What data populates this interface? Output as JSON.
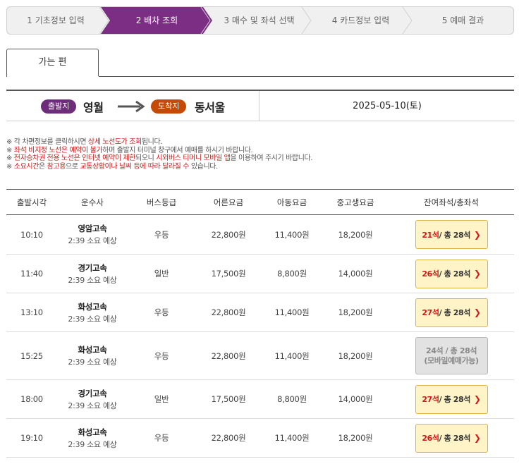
{
  "steps": [
    {
      "num": "1",
      "label": "기초정보 입력"
    },
    {
      "num": "2",
      "label": "배차 조회"
    },
    {
      "num": "3",
      "label": "매수 및 좌석 선택"
    },
    {
      "num": "4",
      "label": "카드정보 입력"
    },
    {
      "num": "5",
      "label": "예매 결과"
    }
  ],
  "active_step_index": 1,
  "colors": {
    "active_step": "#7b2e83",
    "departure_badge": "#6e2d78",
    "arrival_badge": "#c54a06",
    "highlight_red": "#d01818",
    "seat_button_bg": "#fff4c7"
  },
  "tab": {
    "label": "가는 편"
  },
  "route": {
    "departure_badge": "출발지",
    "departure_city": "영월",
    "arrival_badge": "도착지",
    "arrival_city": "동서울",
    "date": "2025-05-10(토)"
  },
  "notes": {
    "line1": {
      "a": "※ 각 차편정보를 클릭하시면 ",
      "b": "상세 노선도가 조회",
      "c": "됩니다."
    },
    "line2": {
      "a": "※ ",
      "b": "좌석 비지정 노선은 예약이 불가",
      "c": "하며 출발지 터미널 창구에서 예매를 하시기 바랍니다."
    },
    "line3": {
      "a": "※ ",
      "b": "전자승차권 전용 노선은 인터넷 예약이 제한",
      "c": "되오니 ",
      "d": "시외버스 티머니 모바일 앱",
      "e": "을 이용하여 주시기 바랍니다."
    },
    "line4": {
      "a": "※ ",
      "b": "소요시간",
      "c": "은 ",
      "d": "참고용",
      "e": "으로 ",
      "f": "교통상황이나 날씨 등에 따라 달라질 수",
      "g": " 있습니다."
    }
  },
  "table": {
    "headers": [
      "출발시각",
      "운수사",
      "버스등급",
      "어른요금",
      "아동요금",
      "중고생요금",
      "잔여좌석/총좌석"
    ],
    "rows": [
      {
        "time": "10:10",
        "company": "영암고속",
        "duration": "2:39 소요 예상",
        "grade": "우등",
        "adult": "22,800원",
        "child": "11,400원",
        "student": "18,200원",
        "remaining": "21석",
        "total": " / 총 28석",
        "note": "",
        "available": true
      },
      {
        "time": "11:40",
        "company": "경기고속",
        "duration": "2:39 소요 예상",
        "grade": "일반",
        "adult": "17,500원",
        "child": "8,800원",
        "student": "14,000원",
        "remaining": "26석",
        "total": " / 총 28석",
        "note": "",
        "available": true
      },
      {
        "time": "13:10",
        "company": "화성고속",
        "duration": "2:39 소요 예상",
        "grade": "우등",
        "adult": "22,800원",
        "child": "11,400원",
        "student": "18,200원",
        "remaining": "27석",
        "total": " / 총 28석",
        "note": "",
        "available": true
      },
      {
        "time": "15:25",
        "company": "화성고속",
        "duration": "2:39 소요 예상",
        "grade": "우등",
        "adult": "22,800원",
        "child": "11,400원",
        "student": "18,200원",
        "remaining": "24석",
        "total": " / 총 28석",
        "note": "(모바일예매가능)",
        "available": false
      },
      {
        "time": "18:00",
        "company": "경기고속",
        "duration": "2:39 소요 예상",
        "grade": "일반",
        "adult": "17,500원",
        "child": "8,800원",
        "student": "14,000원",
        "remaining": "27석",
        "total": " / 총 28석",
        "note": "",
        "available": true
      },
      {
        "time": "19:10",
        "company": "화성고속",
        "duration": "2:39 소요 예상",
        "grade": "우등",
        "adult": "22,800원",
        "child": "11,400원",
        "student": "18,200원",
        "remaining": "26석",
        "total": " / 총 28석",
        "note": "",
        "available": true
      }
    ]
  }
}
